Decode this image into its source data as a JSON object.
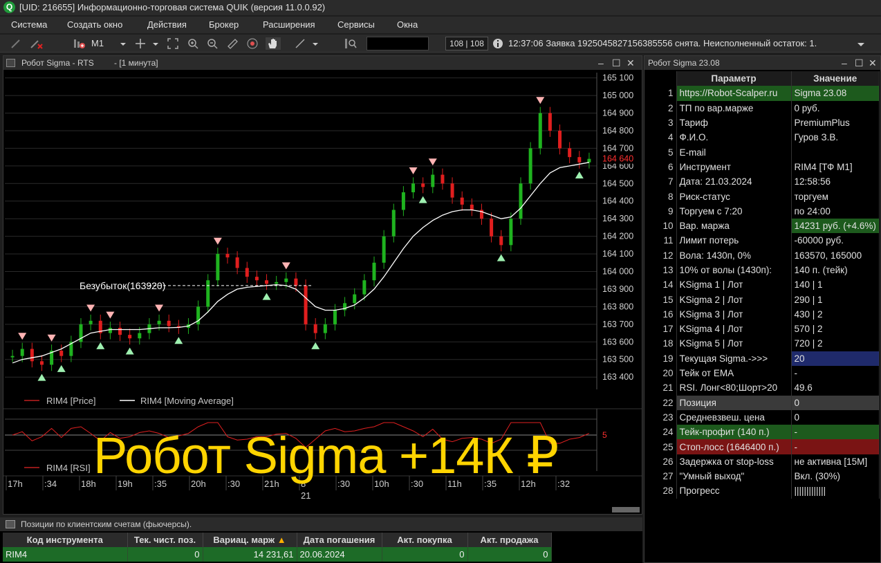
{
  "titlebar": {
    "logo": "Q",
    "title": "[UID: 216655] Информационно-торговая система QUIK (версия 11.0.0.92)"
  },
  "menu": [
    "Система",
    "Создать окно",
    "Действия",
    "Брокер",
    "Расширения",
    "Сервисы",
    "Окна"
  ],
  "toolbar": {
    "interval": "M1",
    "counter": "108 | 108",
    "status": "12:37:06  Заявка 1925045827156385556 снята. Неисполненный остаток: 1."
  },
  "chart_window": {
    "title": "Робот Sigma - RTS",
    "subtitle": "- [1 минута]"
  },
  "chart_data": {
    "type": "line",
    "price_axis": [
      "165 100",
      "165 000",
      "164 900",
      "164 800",
      "164 700",
      "164 600",
      "164 500",
      "164 400",
      "164 300",
      "164 200",
      "164 100",
      "164 000",
      "163 900",
      "163 800",
      "163 700",
      "163 600",
      "163 500",
      "163 400"
    ],
    "last_price": "164 640",
    "ylim": [
      163330,
      165130
    ],
    "breakeven_label": "Безубыток(163920)",
    "breakeven_value": 163920,
    "legend": [
      {
        "name": "RIM4 [Price]",
        "color": "#c02020"
      },
      {
        "name": "RIM4 [Moving Average]",
        "color": "#ffffff"
      }
    ],
    "rsi_legend": "RIM4 [RSI]",
    "rsi_tick": "5",
    "time_axis": [
      "17h",
      ":34",
      "18h",
      "19h",
      ":35",
      "20h",
      ":30",
      "21h",
      "8",
      ":30",
      "10h",
      ":30",
      "11h",
      ":35",
      "12h",
      ":32"
    ],
    "date_label": "21",
    "price_series": [
      163520,
      163560,
      163490,
      163470,
      163550,
      163520,
      163600,
      163700,
      163720,
      163650,
      163680,
      163640,
      163620,
      163650,
      163700,
      163720,
      163690,
      163680,
      163700,
      163800,
      163950,
      164100,
      164080,
      164020,
      163970,
      163950,
      163930,
      163940,
      163960,
      163920,
      163700,
      163650,
      163700,
      163780,
      163820,
      163870,
      163950,
      164050,
      164200,
      164350,
      164450,
      164500,
      164480,
      164550,
      164500,
      164420,
      164380,
      164350,
      164300,
      164200,
      164150,
      164300,
      164500,
      164700,
      164900,
      164800,
      164700,
      164650,
      164620,
      164640
    ],
    "ma_series": [
      163480,
      163500,
      163510,
      163520,
      163540,
      163560,
      163590,
      163620,
      163650,
      163660,
      163670,
      163670,
      163670,
      163670,
      163675,
      163680,
      163680,
      163682,
      163690,
      163720,
      163770,
      163830,
      163870,
      163900,
      163910,
      163915,
      163920,
      163925,
      163920,
      163900,
      163850,
      163800,
      163780,
      163780,
      163790,
      163810,
      163850,
      163900,
      163970,
      164050,
      164130,
      164200,
      164250,
      164290,
      164320,
      164340,
      164350,
      164350,
      164340,
      164320,
      164300,
      164310,
      164360,
      164430,
      164500,
      164560,
      164590,
      164600,
      164610,
      164620
    ]
  },
  "param_window": {
    "title": "Робот Sigma 23.08",
    "headers": [
      "Параметр",
      "Значение"
    ],
    "rows": [
      {
        "n": "1",
        "p": "https://Robot-Scalper.ru",
        "v": "Sigma 23.08",
        "bg": "#1d5a1d",
        "vbg": "#1d5a1d"
      },
      {
        "n": "2",
        "p": "ТП по вар.марже",
        "v": "0 руб.",
        "bg": "",
        "vbg": ""
      },
      {
        "n": "3",
        "p": "Тариф",
        "v": "PremiumPlus",
        "bg": "",
        "vbg": ""
      },
      {
        "n": "4",
        "p": "Ф.И.О.",
        "v": "Гуров З.В.",
        "bg": "",
        "vbg": ""
      },
      {
        "n": "5",
        "p": "E-mail",
        "v": "",
        "bg": "",
        "vbg": ""
      },
      {
        "n": "6",
        "p": "Инструмент",
        "v": "RIM4 [ТФ М1]",
        "bg": "",
        "vbg": ""
      },
      {
        "n": "7",
        "p": "Дата: 21.03.2024",
        "v": "12:58:56",
        "bg": "",
        "vbg": ""
      },
      {
        "n": "8",
        "p": "Риск-статус",
        "v": "торгуем",
        "bg": "",
        "vbg": ""
      },
      {
        "n": "9",
        "p": "Торгуем с 7:20",
        "v": "по 24:00",
        "bg": "",
        "vbg": ""
      },
      {
        "n": "10",
        "p": "Вар. маржа",
        "v": "14231 руб. (+4.6%)",
        "bg": "",
        "vbg": "#1d5a1d"
      },
      {
        "n": "11",
        "p": "Лимит потерь",
        "v": "-60000 руб.",
        "bg": "",
        "vbg": ""
      },
      {
        "n": "12",
        "p": "Вола: 1430п, 0%",
        "v": "163570, 165000",
        "bg": "",
        "vbg": ""
      },
      {
        "n": "13",
        "p": "10% от волы (1430п):",
        "v": "140 п. (тейк)",
        "bg": "",
        "vbg": ""
      },
      {
        "n": "14",
        "p": "KSigma 1 | Лот",
        "v": "140 | 1",
        "bg": "",
        "vbg": ""
      },
      {
        "n": "15",
        "p": "KSigma 2 | Лот",
        "v": "290 | 1",
        "bg": "",
        "vbg": ""
      },
      {
        "n": "16",
        "p": "KSigma 3 | Лот",
        "v": "430 | 2",
        "bg": "",
        "vbg": ""
      },
      {
        "n": "17",
        "p": "KSigma 4 | Лот",
        "v": "570 | 2",
        "bg": "",
        "vbg": ""
      },
      {
        "n": "18",
        "p": "KSigma 5 | Лот",
        "v": "720 | 2",
        "bg": "",
        "vbg": ""
      },
      {
        "n": "19",
        "p": "Текущая Sigma.->>>",
        "v": "20",
        "bg": "",
        "vbg": "#1f2a6b"
      },
      {
        "n": "20",
        "p": "Тейк от EMA",
        "v": " -",
        "bg": "",
        "vbg": ""
      },
      {
        "n": "21",
        "p": "RSI. Лонг<80;Шорт>20",
        "v": "49.6",
        "bg": "",
        "vbg": ""
      },
      {
        "n": "22",
        "p": "Позиция",
        "v": "0",
        "bg": "#3a3a3a",
        "vbg": "#3a3a3a"
      },
      {
        "n": "23",
        "p": "Средневзвеш. цена",
        "v": "0",
        "bg": "",
        "vbg": ""
      },
      {
        "n": "24",
        "p": "Тейк-профит (140 п.)",
        "v": "-",
        "bg": "#1d5a1d",
        "vbg": "#1d5a1d"
      },
      {
        "n": "25",
        "p": "Стоп-лосс (1646400 п.)",
        "v": "-",
        "bg": "#7a1414",
        "vbg": "#7a1414"
      },
      {
        "n": "26",
        "p": "Задержка от stop-loss",
        "v": "не активна [15M]",
        "bg": "",
        "vbg": ""
      },
      {
        "n": "27",
        "p": "\"Умный выход\"",
        "v": "Вкл. (30%)",
        "bg": "",
        "vbg": ""
      },
      {
        "n": "28",
        "p": "Прогресс",
        "v": "|||||||||||||",
        "bg": "",
        "vbg": ""
      }
    ]
  },
  "positions_window": {
    "title": "Позиции по клиентским счетам (фьючерсы).",
    "headers": [
      "Код инструмента",
      "Тек. чист. поз.",
      "Вариац. марж",
      "Дата погашения",
      "Акт. покупка",
      "Акт. продажа"
    ],
    "row": [
      "RIM4",
      "0",
      "14 231,61",
      "20.06.2024",
      "0",
      "0"
    ]
  },
  "overlay_text": "Робот Sigma +14К ₽",
  "colors": {
    "up": "#1fb31f",
    "down": "#e01e1e",
    "buy_marker": "#9ef0b0",
    "sell_marker": "#ffb3b3",
    "overlay": "#ffd400"
  }
}
